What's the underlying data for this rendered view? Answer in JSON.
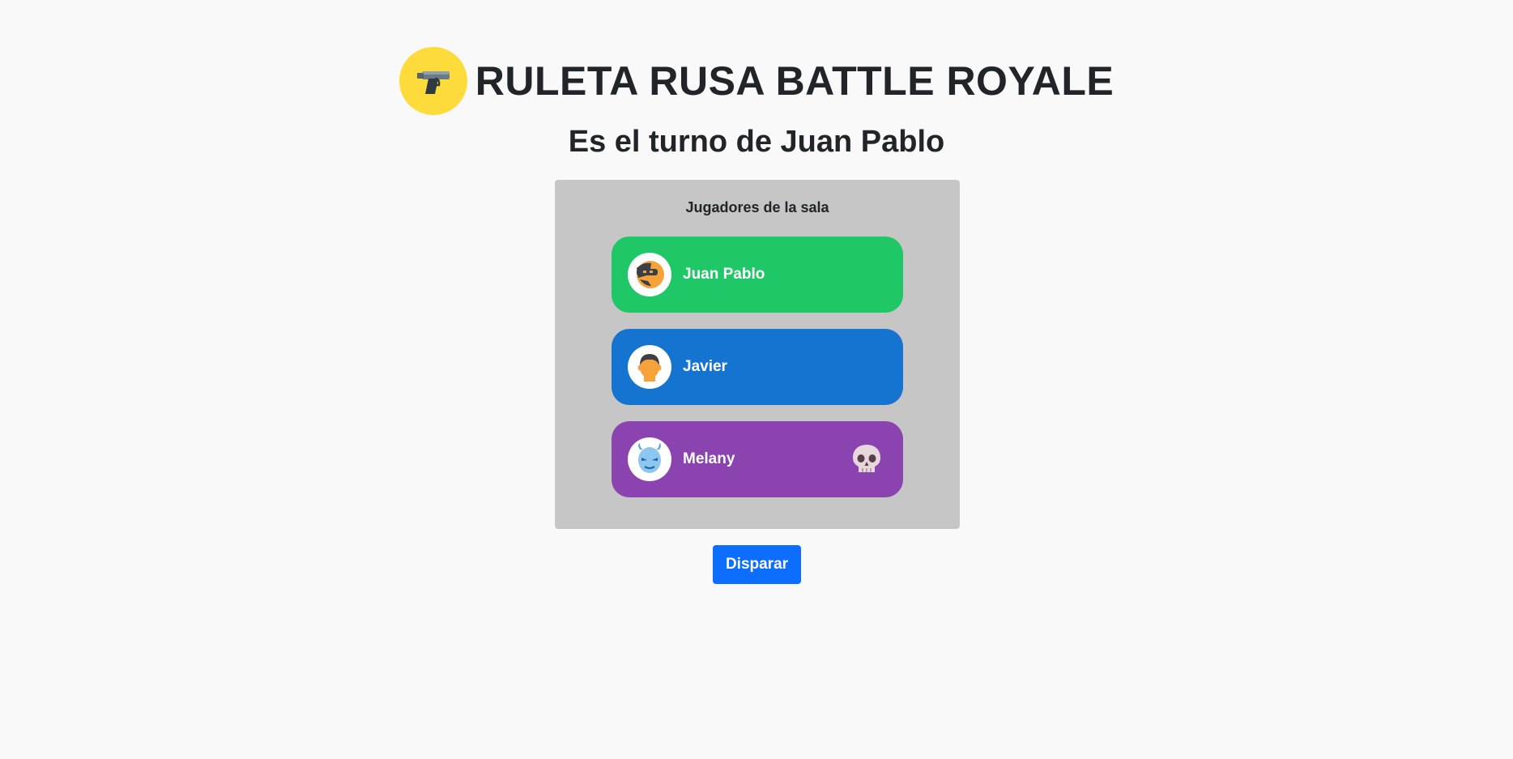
{
  "header": {
    "title": "RULETA RUSA BATTLE ROYALE",
    "logo_icon": "pistol-icon",
    "logo_color": "#fddb3a"
  },
  "turn_text": "Es el turno de Juan Pablo",
  "room": {
    "title": "Jugadores de la sala",
    "background": "#c6c6c6",
    "players": [
      {
        "name": "Juan Pablo",
        "avatar": "ninja-avatar-icon",
        "color": "#20c767",
        "eliminated": false
      },
      {
        "name": "Javier",
        "avatar": "man-avatar-icon",
        "color": "#1674d1",
        "eliminated": false
      },
      {
        "name": "Melany",
        "avatar": "ghost-demon-avatar-icon",
        "color": "#8a43af",
        "eliminated": true,
        "status_icon": "skull-icon"
      }
    ]
  },
  "actions": {
    "shoot_label": "Disparar",
    "shoot_color": "#0d6efd"
  }
}
